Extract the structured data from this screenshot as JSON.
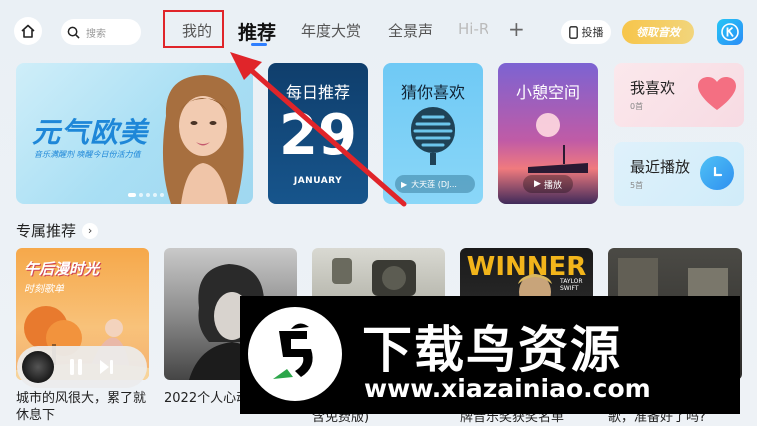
{
  "header": {
    "search_placeholder": "搜索",
    "tabs": [
      {
        "label": "我的"
      },
      {
        "label": "推荐"
      },
      {
        "label": "年度大赏"
      },
      {
        "label": "全景声"
      },
      {
        "label": "Hi-Res"
      }
    ],
    "cast_label": "投播",
    "vip_label": "领取音效"
  },
  "banner": {
    "title": "元气欧美",
    "subtitle": "音乐满醒剂 唤醒今日份活力值"
  },
  "cards": {
    "daily": {
      "title": "每日推荐",
      "day": "29",
      "month": "JANUARY"
    },
    "guess": {
      "title": "猜你喜欢",
      "chip": "大天莲 (DJ..."
    },
    "rest": {
      "title": "小憩空间",
      "chip": "播放"
    },
    "favorites": {
      "title": "我喜欢",
      "count": "0首"
    },
    "recent": {
      "title": "最近播放",
      "count": "5首"
    }
  },
  "section": {
    "title": "专属推荐"
  },
  "thumbs": [
    {
      "title": "午后漫时光",
      "subtitle": "时刻歌单"
    },
    {},
    {},
    {
      "title": "WINNER",
      "tag": "TAYLOR SWIFT"
    },
    {}
  ],
  "captions": [
    "城市的风很大，累了就休息下",
    "2022个人心动推介",
    "含免费版)",
    "牌音乐奖获奖名单",
    "歌，准备好了吗?"
  ],
  "watermark": {
    "title": "下载鸟资源",
    "url": "www.xiazainiao.com"
  },
  "colors": {
    "accent": "#2f7fff",
    "highlight": "#e0252a"
  }
}
